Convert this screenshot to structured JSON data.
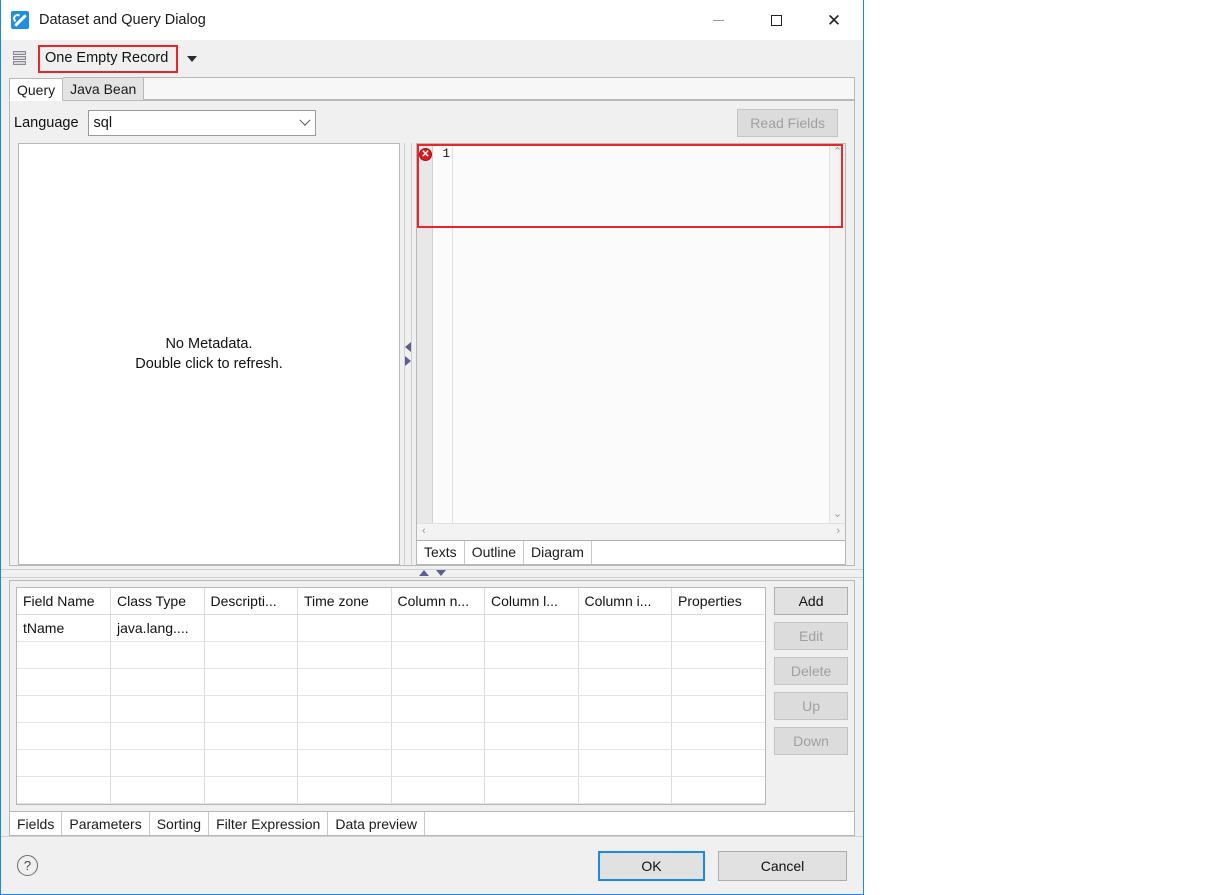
{
  "window": {
    "title": "Dataset and Query Dialog",
    "icon": "app-icon",
    "controls": {
      "minimize": "–",
      "maximize": "□",
      "close": "✕"
    }
  },
  "repository": {
    "icon": "database-icon",
    "name": "One Empty Record",
    "dropdown_caret": "▾",
    "highlight_color": "#e8272d"
  },
  "main_tabs": [
    {
      "label": "Query",
      "active": true
    },
    {
      "label": "Java Bean",
      "active": false
    }
  ],
  "query": {
    "language_label": "Language",
    "language_value": "sql",
    "language_placeholder": "sql",
    "read_fields_label": "Read Fields",
    "read_fields_enabled": false,
    "metadata_line1": "No Metadata.",
    "metadata_line2": "Double click to refresh.",
    "editor": {
      "line_number": "1",
      "error_marker": "error-icon",
      "error_marker_glyph": "✕",
      "content": "",
      "highlight_color": "#e8272d",
      "tabs": [
        {
          "label": "Texts",
          "active": true
        },
        {
          "label": "Outline",
          "active": false
        },
        {
          "label": "Diagram",
          "active": false
        }
      ],
      "scroll_up": "⌃",
      "scroll_down": "⌄",
      "scroll_left": "‹",
      "scroll_right": "›"
    }
  },
  "fields_table": {
    "columns": [
      "Field Name",
      "Class Type",
      "Descripti...",
      "Time zone",
      "Column n...",
      "Column l...",
      "Column i...",
      "Properties"
    ],
    "rows": [
      [
        "tName",
        "java.lang....",
        "",
        "",
        "",
        "",
        "",
        ""
      ],
      [
        "",
        "",
        "",
        "",
        "",
        "",
        "",
        ""
      ],
      [
        "",
        "",
        "",
        "",
        "",
        "",
        "",
        ""
      ],
      [
        "",
        "",
        "",
        "",
        "",
        "",
        "",
        ""
      ],
      [
        "",
        "",
        "",
        "",
        "",
        "",
        "",
        ""
      ],
      [
        "",
        "",
        "",
        "",
        "",
        "",
        "",
        ""
      ],
      [
        "",
        "",
        "",
        "",
        "",
        "",
        "",
        ""
      ]
    ],
    "buttons": [
      {
        "label": "Add",
        "enabled": true
      },
      {
        "label": "Edit",
        "enabled": false
      },
      {
        "label": "Delete",
        "enabled": false
      },
      {
        "label": "Up",
        "enabled": false
      },
      {
        "label": "Down",
        "enabled": false
      }
    ]
  },
  "bottom_tabs": [
    {
      "label": "Fields",
      "active": true
    },
    {
      "label": "Parameters",
      "active": false
    },
    {
      "label": "Sorting",
      "active": false
    },
    {
      "label": "Filter Expression",
      "active": false
    },
    {
      "label": "Data preview",
      "active": false
    }
  ],
  "footer": {
    "help_icon": "?",
    "ok_label": "OK",
    "cancel_label": "Cancel",
    "focus_color": "#1a8ae5"
  }
}
